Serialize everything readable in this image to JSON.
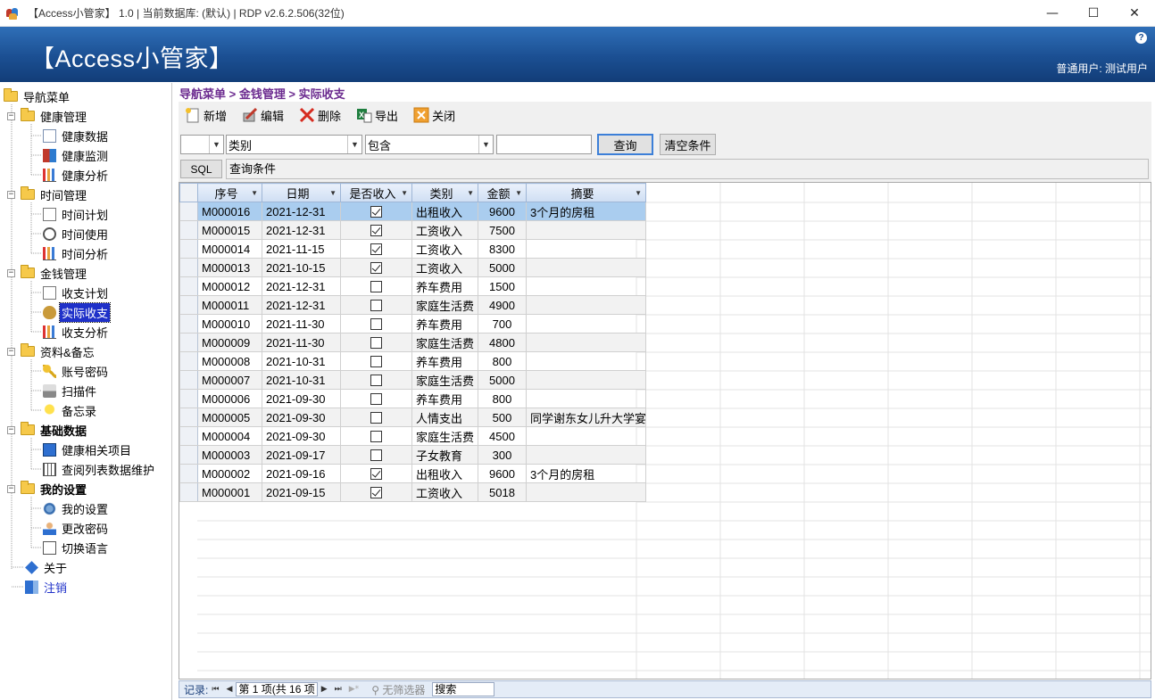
{
  "window": {
    "title": "【Access小管家】 1.0 | 当前数据库: (默认) | RDP v2.6.2.506(32位)",
    "minimize": "—",
    "maximize": "☐",
    "close": "✕"
  },
  "header": {
    "app_name": "【Access小管家】",
    "help": "?",
    "user": "普通用户: 测试用户"
  },
  "sidebar": {
    "root": "导航菜单",
    "groups": [
      {
        "label": "健康管理",
        "bold": false,
        "items": [
          "健康数据",
          "健康监测",
          "健康分析"
        ]
      },
      {
        "label": "时间管理",
        "bold": false,
        "items": [
          "时间计划",
          "时间使用",
          "时间分析"
        ]
      },
      {
        "label": "金钱管理",
        "bold": false,
        "items": [
          "收支计划",
          "实际收支",
          "收支分析"
        ]
      },
      {
        "label": "资料&备忘",
        "bold": false,
        "items": [
          "账号密码",
          "扫描件",
          "备忘录"
        ]
      },
      {
        "label": "基础数据",
        "bold": true,
        "items": [
          "健康相关项目",
          "查阅列表数据维护"
        ]
      },
      {
        "label": "我的设置",
        "bold": true,
        "items": [
          "我的设置",
          "更改密码",
          "切换语言"
        ]
      }
    ],
    "about": "关于",
    "logout": "注销",
    "selected_item": "实际收支"
  },
  "breadcrumb": "导航菜单 > 金钱管理 > 实际收支",
  "toolbar": {
    "new": "新增",
    "edit": "编辑",
    "delete": "删除",
    "export": "导出",
    "close": "关闭"
  },
  "filter": {
    "field1": "",
    "field2": "类别",
    "operator": "包含",
    "value": "",
    "query_button": "查询",
    "clear_button": "清空条件",
    "sql_button": "SQL",
    "condition_label": "查询条件"
  },
  "table": {
    "columns": [
      "序号",
      "日期",
      "是否收入",
      "类别",
      "金额",
      "摘要"
    ],
    "rows": [
      {
        "id": "M000016",
        "date": "2021-12-31",
        "income": true,
        "category": "出租收入",
        "amount": "9600",
        "note": "3个月的房租"
      },
      {
        "id": "M000015",
        "date": "2021-12-31",
        "income": true,
        "category": "工资收入",
        "amount": "7500",
        "note": ""
      },
      {
        "id": "M000014",
        "date": "2021-11-15",
        "income": true,
        "category": "工资收入",
        "amount": "8300",
        "note": ""
      },
      {
        "id": "M000013",
        "date": "2021-10-15",
        "income": true,
        "category": "工资收入",
        "amount": "5000",
        "note": ""
      },
      {
        "id": "M000012",
        "date": "2021-12-31",
        "income": false,
        "category": "养车费用",
        "amount": "1500",
        "note": ""
      },
      {
        "id": "M000011",
        "date": "2021-12-31",
        "income": false,
        "category": "家庭生活费",
        "amount": "4900",
        "note": ""
      },
      {
        "id": "M000010",
        "date": "2021-11-30",
        "income": false,
        "category": "养车费用",
        "amount": "700",
        "note": ""
      },
      {
        "id": "M000009",
        "date": "2021-11-30",
        "income": false,
        "category": "家庭生活费",
        "amount": "4800",
        "note": ""
      },
      {
        "id": "M000008",
        "date": "2021-10-31",
        "income": false,
        "category": "养车费用",
        "amount": "800",
        "note": ""
      },
      {
        "id": "M000007",
        "date": "2021-10-31",
        "income": false,
        "category": "家庭生活费",
        "amount": "5000",
        "note": ""
      },
      {
        "id": "M000006",
        "date": "2021-09-30",
        "income": false,
        "category": "养车费用",
        "amount": "800",
        "note": ""
      },
      {
        "id": "M000005",
        "date": "2021-09-30",
        "income": false,
        "category": "人情支出",
        "amount": "500",
        "note": "同学谢东女儿升大学宴"
      },
      {
        "id": "M000004",
        "date": "2021-09-30",
        "income": false,
        "category": "家庭生活费",
        "amount": "4500",
        "note": ""
      },
      {
        "id": "M000003",
        "date": "2021-09-17",
        "income": false,
        "category": "子女教育",
        "amount": "300",
        "note": ""
      },
      {
        "id": "M000002",
        "date": "2021-09-16",
        "income": true,
        "category": "出租收入",
        "amount": "9600",
        "note": "3个月的房租"
      },
      {
        "id": "M000001",
        "date": "2021-09-15",
        "income": true,
        "category": "工资收入",
        "amount": "5018",
        "note": ""
      }
    ]
  },
  "navbar": {
    "record_label": "记录:",
    "page_text": "第 1 项(共 16 项",
    "filter_text": "无筛选器",
    "search_text": "搜索"
  }
}
